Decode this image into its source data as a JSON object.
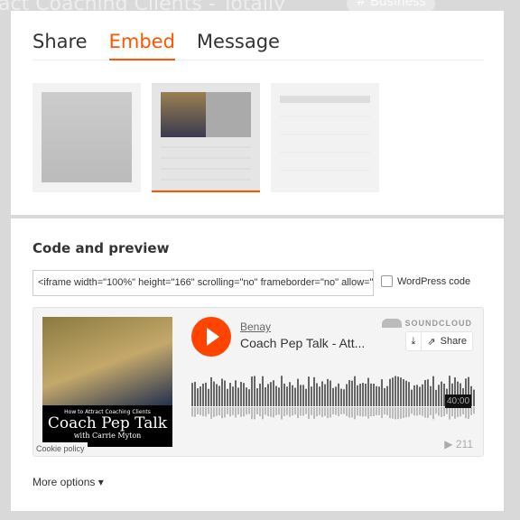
{
  "background": {
    "title": "act Coaching Clients - Totally",
    "tag": "# Business"
  },
  "tabs": [
    {
      "label": "Share"
    },
    {
      "label": "Embed",
      "active": true
    },
    {
      "label": "Message"
    }
  ],
  "accent": "#ff5500",
  "section_title": "Code and preview",
  "embed_code": "<iframe width=\"100%\" height=\"166\" scrolling=\"no\" frameborder=\"no\" allow=\"autoplay\"",
  "wordpress_label": "WordPress code",
  "wordpress_checked": false,
  "player": {
    "user": "Benay",
    "track_title": "Coach Pep Talk - Att...",
    "brand": "SOUNDCLOUD",
    "share_label": "Share",
    "duration": "40:00",
    "plays": "211",
    "artwork": {
      "line1": "How to Attract Coaching Clients",
      "line2": "Coach Pep Talk",
      "line3": "with Carrie Myton"
    },
    "cookie_label": "Cookie policy"
  },
  "more_options": "More options"
}
